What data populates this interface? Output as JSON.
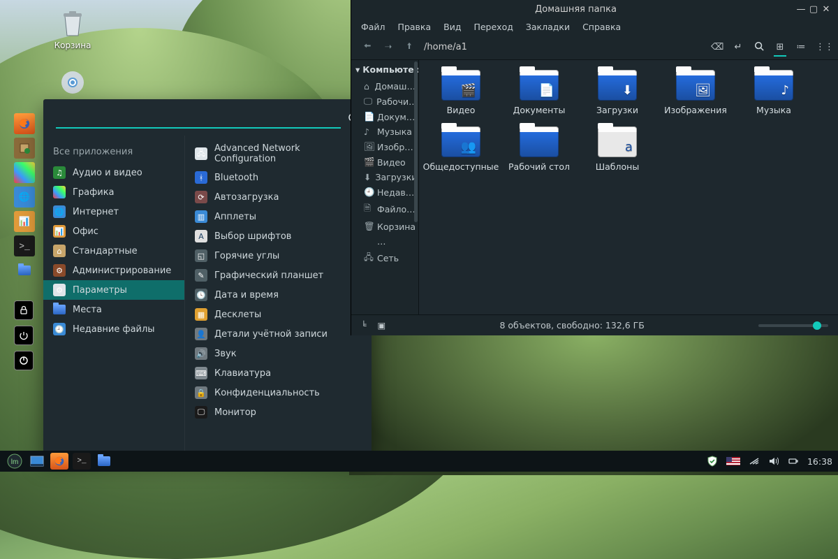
{
  "desktop": {
    "trash": "Корзина"
  },
  "menu": {
    "search_placeholder": "",
    "all_apps": "Все приложения",
    "categories": [
      {
        "label": "Аудио и видео"
      },
      {
        "label": "Графика"
      },
      {
        "label": "Интернет"
      },
      {
        "label": "Офис"
      },
      {
        "label": "Стандартные"
      },
      {
        "label": "Администрирование"
      },
      {
        "label": "Параметры",
        "selected": true
      },
      {
        "label": "Места"
      },
      {
        "label": "Недавние файлы"
      }
    ],
    "apps": [
      {
        "label": "Advanced Network Configuration"
      },
      {
        "label": "Bluetooth"
      },
      {
        "label": "Автозагрузка"
      },
      {
        "label": "Апплеты"
      },
      {
        "label": "Выбор шрифтов"
      },
      {
        "label": "Горячие углы"
      },
      {
        "label": "Графический планшет"
      },
      {
        "label": "Дата и время"
      },
      {
        "label": "Десклеты"
      },
      {
        "label": "Детали учётной записи"
      },
      {
        "label": "Звук"
      },
      {
        "label": "Клавиатура"
      },
      {
        "label": "Конфиденциальность"
      },
      {
        "label": "Монитор"
      }
    ]
  },
  "fm": {
    "title": "Домашняя папка",
    "menus": [
      "Файл",
      "Правка",
      "Вид",
      "Переход",
      "Закладки",
      "Справка"
    ],
    "path": "/home/a1",
    "side_header": "Компьютер",
    "side_items": [
      "Домаш…",
      "Рабочи…",
      "Докум…",
      "Музыка",
      "Изобр…",
      "Видео",
      "Загрузки",
      "Недав…",
      "Файло…",
      "Корзина",
      "…",
      "Сеть"
    ],
    "folders": [
      {
        "label": "Видео",
        "emblem": "🎬"
      },
      {
        "label": "Документы",
        "emblem": "📄"
      },
      {
        "label": "Загрузки",
        "emblem": "⬇"
      },
      {
        "label": "Изображения",
        "emblem": "🖼"
      },
      {
        "label": "Музыка",
        "emblem": "♪"
      },
      {
        "label": "Общедоступные",
        "emblem": "👥"
      },
      {
        "label": "Рабочий стол",
        "emblem": ""
      },
      {
        "label": "Шаблоны",
        "emblem": "a",
        "tpl": true
      }
    ],
    "status": "8 объектов, свободно: 132,6 ГБ"
  },
  "taskbar": {
    "clock": "16:38"
  }
}
